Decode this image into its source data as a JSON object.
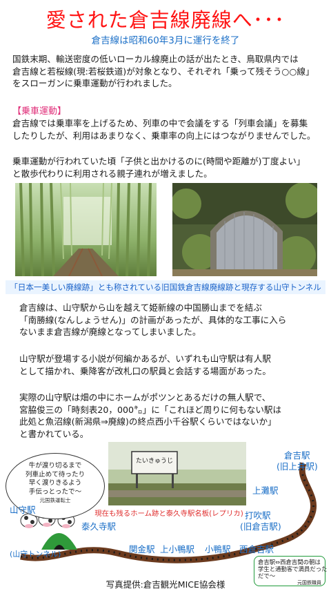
{
  "header": {
    "title": "愛された倉吉線廃線へ･･･",
    "subtitle": "倉吉線は昭和60年3月に運行を終了"
  },
  "intro": {
    "lines": [
      "国鉄末期、輸送密度の低いローカル線廃止の話が出たとき、鳥取県内では",
      "倉吉線と若桜線(現:若桜鉄道)が対象となり、それぞれ「乗って残そう○○線」",
      "をスローガンに乗車運動が行われました。"
    ]
  },
  "campaign": {
    "heading": "【乗車運動】",
    "lines": [
      "倉吉線では乗車率を上げるため、列車の中で会議をする「列車会議」を募集",
      "したりしたが、利用はあまりなく、乗車率の向上にはつながりませんでした。"
    ]
  },
  "family": {
    "lines": [
      "乗車運動が行われていた頃「子供と出かけるのに(時間や距離が)丁度よい」",
      "と散歩代わりに利用される親子連れが増えました。"
    ]
  },
  "photos": {
    "caption": "「日本一美しい廃線跡」とも称されている旧国鉄倉吉線廃線跡と現存する山守トンネル"
  },
  "nanshou": {
    "lines": [
      "倉吉線は、山守駅から山を越えて姫新線の中国勝山までを結ぶ",
      "「南勝線(なんしょうせん)」の計画があったが、具体的な工事に入ら",
      "ないまま倉吉線が廃線となってしまいました。"
    ]
  },
  "novel": {
    "lines": [
      "山守駅が登場する小説が何編かあるが、いずれも山守駅は有人駅",
      "として描かれ、乗降客が改札口の駅員と会話する場面があった。"
    ]
  },
  "actual": {
    "lines": [
      "実際の山守駅は畑の中にホームがポツンとあるだけの無人駅で、",
      "宮脇俊三の「時刻表20，000㌔」に「これほど周りに何もない駅は",
      "此処と魚沼線(新潟県⇒廃線)の終点西小千谷駅くらいではないか」",
      "と書かれている。"
    ]
  },
  "map": {
    "speech_left": {
      "lines": [
        "牛が渡り切るまで",
        "列車止めて待ったり",
        "早く渡りきるよう",
        "手伝っとったで～"
      ],
      "signature": "元国鉄運転士"
    },
    "speech_right": {
      "lines": [
        "倉吉駅⇔西倉吉間の朝は",
        "学生と通勤客で満員だった",
        "だで～"
      ],
      "signature": "元国鉄職員"
    },
    "photo_caption": "現在も残るホーム跡と泰久寺駅名板(レプリカ)",
    "sign_text": "たいきゅうじ",
    "stations": {
      "kurayoshi": "倉吉駅",
      "kurayoshi_sub": "(旧上井駅)",
      "agenose": "上灘駅",
      "uchibuki": "打吹駅",
      "uchibuki_sub": "(旧倉吉駅)",
      "nishikurayoshi": "西倉吉駅",
      "komori": "小鴨駅",
      "kamikomori": "上小鴨駅",
      "sekigane": "関金駅",
      "taikyuji": "泰久寺駅",
      "yamamori": "山守駅",
      "tunnel": "(山守トンネル)"
    }
  },
  "credit": "写真提供:倉吉観光MICE協会様",
  "colors": {
    "title": "#ff1414",
    "accent_blue": "#1b6fc7",
    "heading_pink": "#e0307a",
    "caption_red": "#e03030",
    "rail_brown": "#6b3a1e"
  }
}
